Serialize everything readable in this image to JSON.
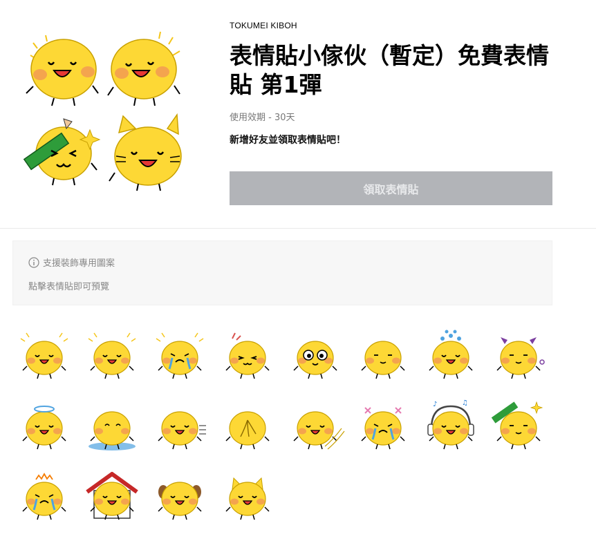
{
  "header": {
    "author": "TOKUMEI KIBOH",
    "title": "表情貼小傢伙（暫定）免費表情貼 第1彈",
    "validity": "使用效期 - 30天",
    "promo": "新增好友並領取表情貼吧！",
    "get_button": "領取表情貼"
  },
  "notice": {
    "line1": "支援裝飾專用圖案",
    "line2": "點擊表情貼即可預覽"
  },
  "stickers": [
    {
      "name": "sticker-happy-sparkle",
      "variant": "happy",
      "deco": "sparkle"
    },
    {
      "name": "sticker-happy-sparkle-2",
      "variant": "happy",
      "deco": "sparkle"
    },
    {
      "name": "sticker-crying-tears",
      "variant": "cry",
      "deco": "sparkle"
    },
    {
      "name": "sticker-angry",
      "variant": "angry",
      "deco": "anger"
    },
    {
      "name": "sticker-shocked",
      "variant": "shock",
      "deco": "none"
    },
    {
      "name": "sticker-smug",
      "variant": "smug",
      "deco": "none"
    },
    {
      "name": "sticker-sweat",
      "variant": "happy",
      "deco": "drops"
    },
    {
      "name": "sticker-devil",
      "variant": "smug",
      "deco": "devil"
    },
    {
      "name": "sticker-angel",
      "variant": "happy",
      "deco": "halo"
    },
    {
      "name": "sticker-melted",
      "variant": "melt",
      "deco": "puddle"
    },
    {
      "name": "sticker-dash",
      "variant": "happy",
      "deco": "dash"
    },
    {
      "name": "sticker-back-view",
      "variant": "back",
      "deco": "none"
    },
    {
      "name": "sticker-sliding",
      "variant": "happy",
      "deco": "slide"
    },
    {
      "name": "sticker-dizzy",
      "variant": "cry",
      "deco": "cross"
    },
    {
      "name": "sticker-music",
      "variant": "happy",
      "deco": "headphones"
    },
    {
      "name": "sticker-pencil",
      "variant": "smug",
      "deco": "pencil"
    },
    {
      "name": "sticker-tantrum",
      "variant": "cry",
      "deco": "crown"
    },
    {
      "name": "sticker-house",
      "variant": "happy",
      "deco": "house"
    },
    {
      "name": "sticker-dog-ears",
      "variant": "happy",
      "deco": "dog"
    },
    {
      "name": "sticker-cat",
      "variant": "happy",
      "deco": "cat"
    }
  ]
}
